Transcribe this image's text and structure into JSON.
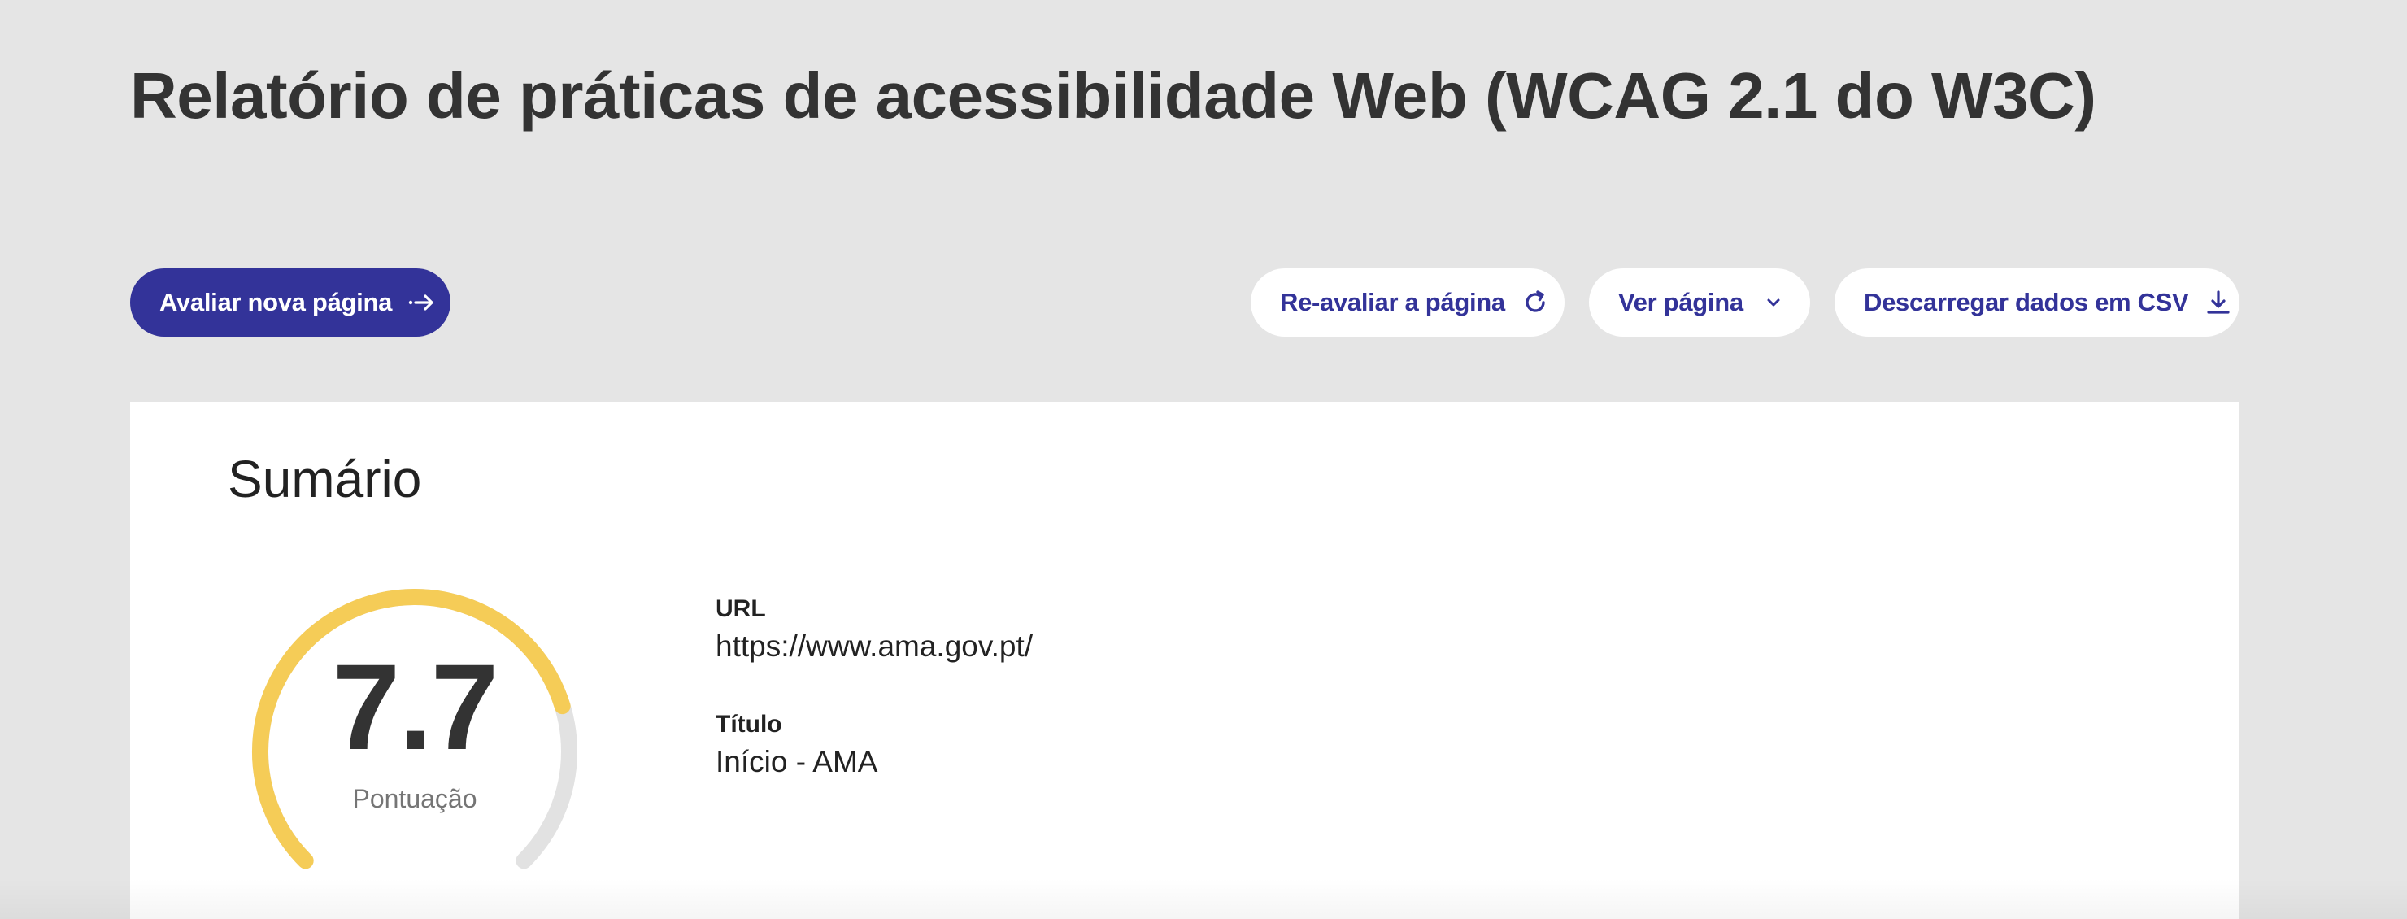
{
  "header": {
    "title": "Relatório de práticas de acessibilidade Web (WCAG 2.1 do W3C)"
  },
  "toolbar": {
    "new_page_label": "Avaliar nova página",
    "reevaluate_label": "Re-avaliar a página",
    "view_page_label": "Ver página",
    "download_csv_label": "Descarregar dados em CSV",
    "icons": {
      "new_page": "arrow-right-icon",
      "reevaluate": "refresh-icon",
      "view_page": "chevron-down-icon",
      "download_csv": "download-icon"
    }
  },
  "summary": {
    "title": "Sumário",
    "score": "7.7",
    "score_value": 7.7,
    "score_max": 10,
    "score_label": "Pontuação",
    "url_label": "URL",
    "url_value": "https://www.ama.gov.pt/",
    "page_title_label": "Título",
    "page_title_value": "Início - AMA"
  },
  "colors": {
    "primary": "#333399",
    "gauge_fill": "#f5cc57",
    "gauge_track": "#e2e2e2",
    "page_background": "#e5e5e5",
    "card_background": "#ffffff"
  }
}
